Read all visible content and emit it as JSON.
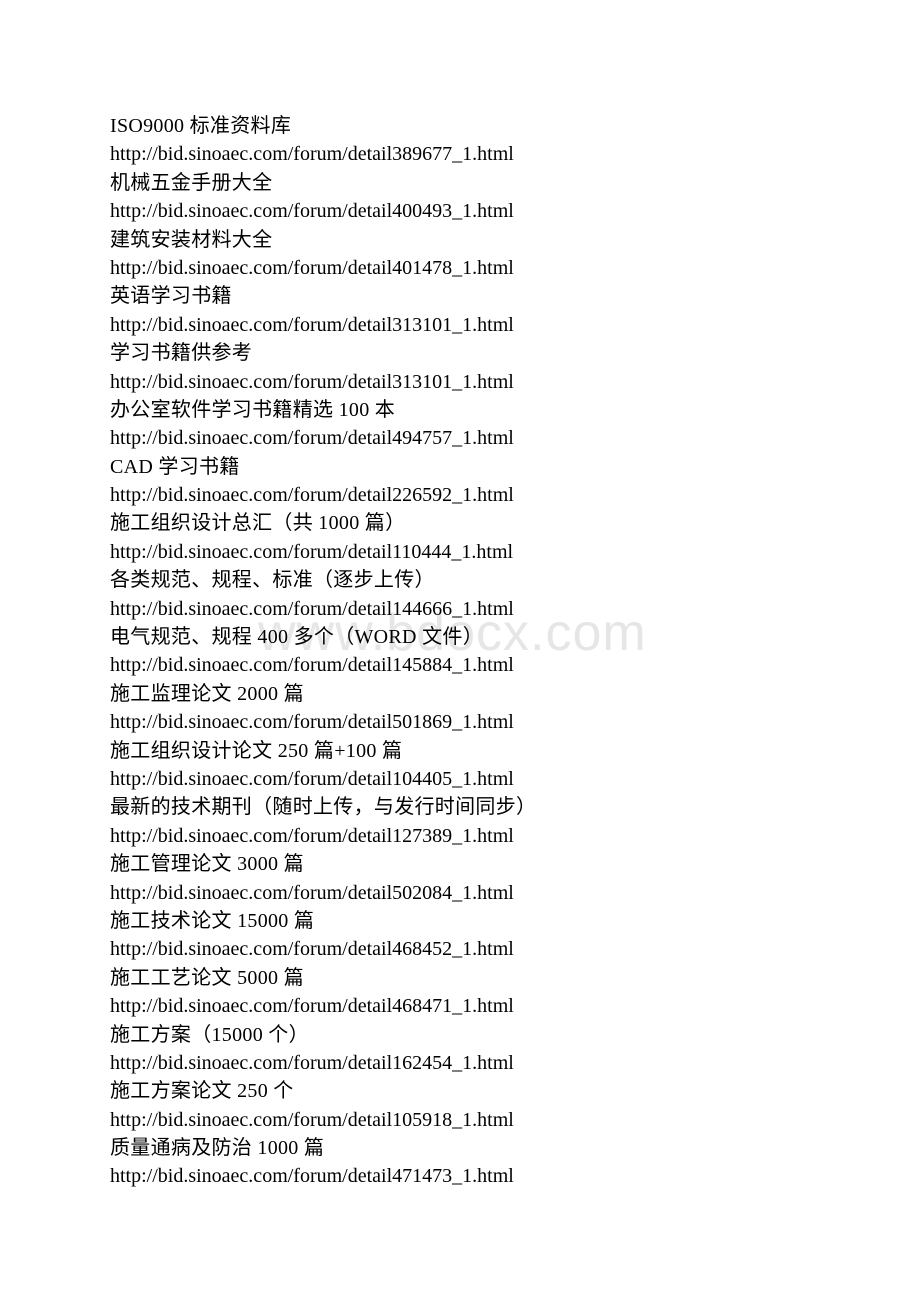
{
  "watermark": "www.bdocx.com",
  "entries": [
    {
      "title": "ISO9000 标准资料库",
      "url": "http://bid.sinoaec.com/forum/detail389677_1.html"
    },
    {
      "title": "机械五金手册大全",
      "url": "http://bid.sinoaec.com/forum/detail400493_1.html"
    },
    {
      "title": "建筑安装材料大全",
      "url": "http://bid.sinoaec.com/forum/detail401478_1.html"
    },
    {
      "title": "英语学习书籍",
      "url": "http://bid.sinoaec.com/forum/detail313101_1.html"
    },
    {
      "title": "学习书籍供参考",
      "url": "http://bid.sinoaec.com/forum/detail313101_1.html"
    },
    {
      "title": "办公室软件学习书籍精选 100 本",
      "url": "http://bid.sinoaec.com/forum/detail494757_1.html"
    },
    {
      "title": "CAD 学习书籍",
      "url": "http://bid.sinoaec.com/forum/detail226592_1.html"
    },
    {
      "title": "施工组织设计总汇（共 1000 篇）",
      "url": "http://bid.sinoaec.com/forum/detail110444_1.html"
    },
    {
      "title": "各类规范、规程、标准（逐步上传）",
      "url": "http://bid.sinoaec.com/forum/detail144666_1.html"
    },
    {
      "title": "电气规范、规程 400 多个（WORD 文件）",
      "url": "http://bid.sinoaec.com/forum/detail145884_1.html"
    },
    {
      "title": "施工监理论文 2000 篇",
      "url": "http://bid.sinoaec.com/forum/detail501869_1.html"
    },
    {
      "title": "施工组织设计论文 250 篇+100 篇",
      "url": "http://bid.sinoaec.com/forum/detail104405_1.html"
    },
    {
      "title": "最新的技术期刊（随时上传，与发行时间同步）",
      "url": "http://bid.sinoaec.com/forum/detail127389_1.html"
    },
    {
      "title": "施工管理论文 3000 篇",
      "url": "http://bid.sinoaec.com/forum/detail502084_1.html"
    },
    {
      "title": "施工技术论文 15000 篇",
      "url": "http://bid.sinoaec.com/forum/detail468452_1.html"
    },
    {
      "title": "施工工艺论文 5000 篇",
      "url": "http://bid.sinoaec.com/forum/detail468471_1.html"
    },
    {
      "title": "施工方案（15000 个）",
      "url": "http://bid.sinoaec.com/forum/detail162454_1.html"
    },
    {
      "title": "施工方案论文 250 个",
      "url": "http://bid.sinoaec.com/forum/detail105918_1.html"
    },
    {
      "title": "质量通病及防治 1000 篇",
      "url": "http://bid.sinoaec.com/forum/detail471473_1.html"
    }
  ]
}
